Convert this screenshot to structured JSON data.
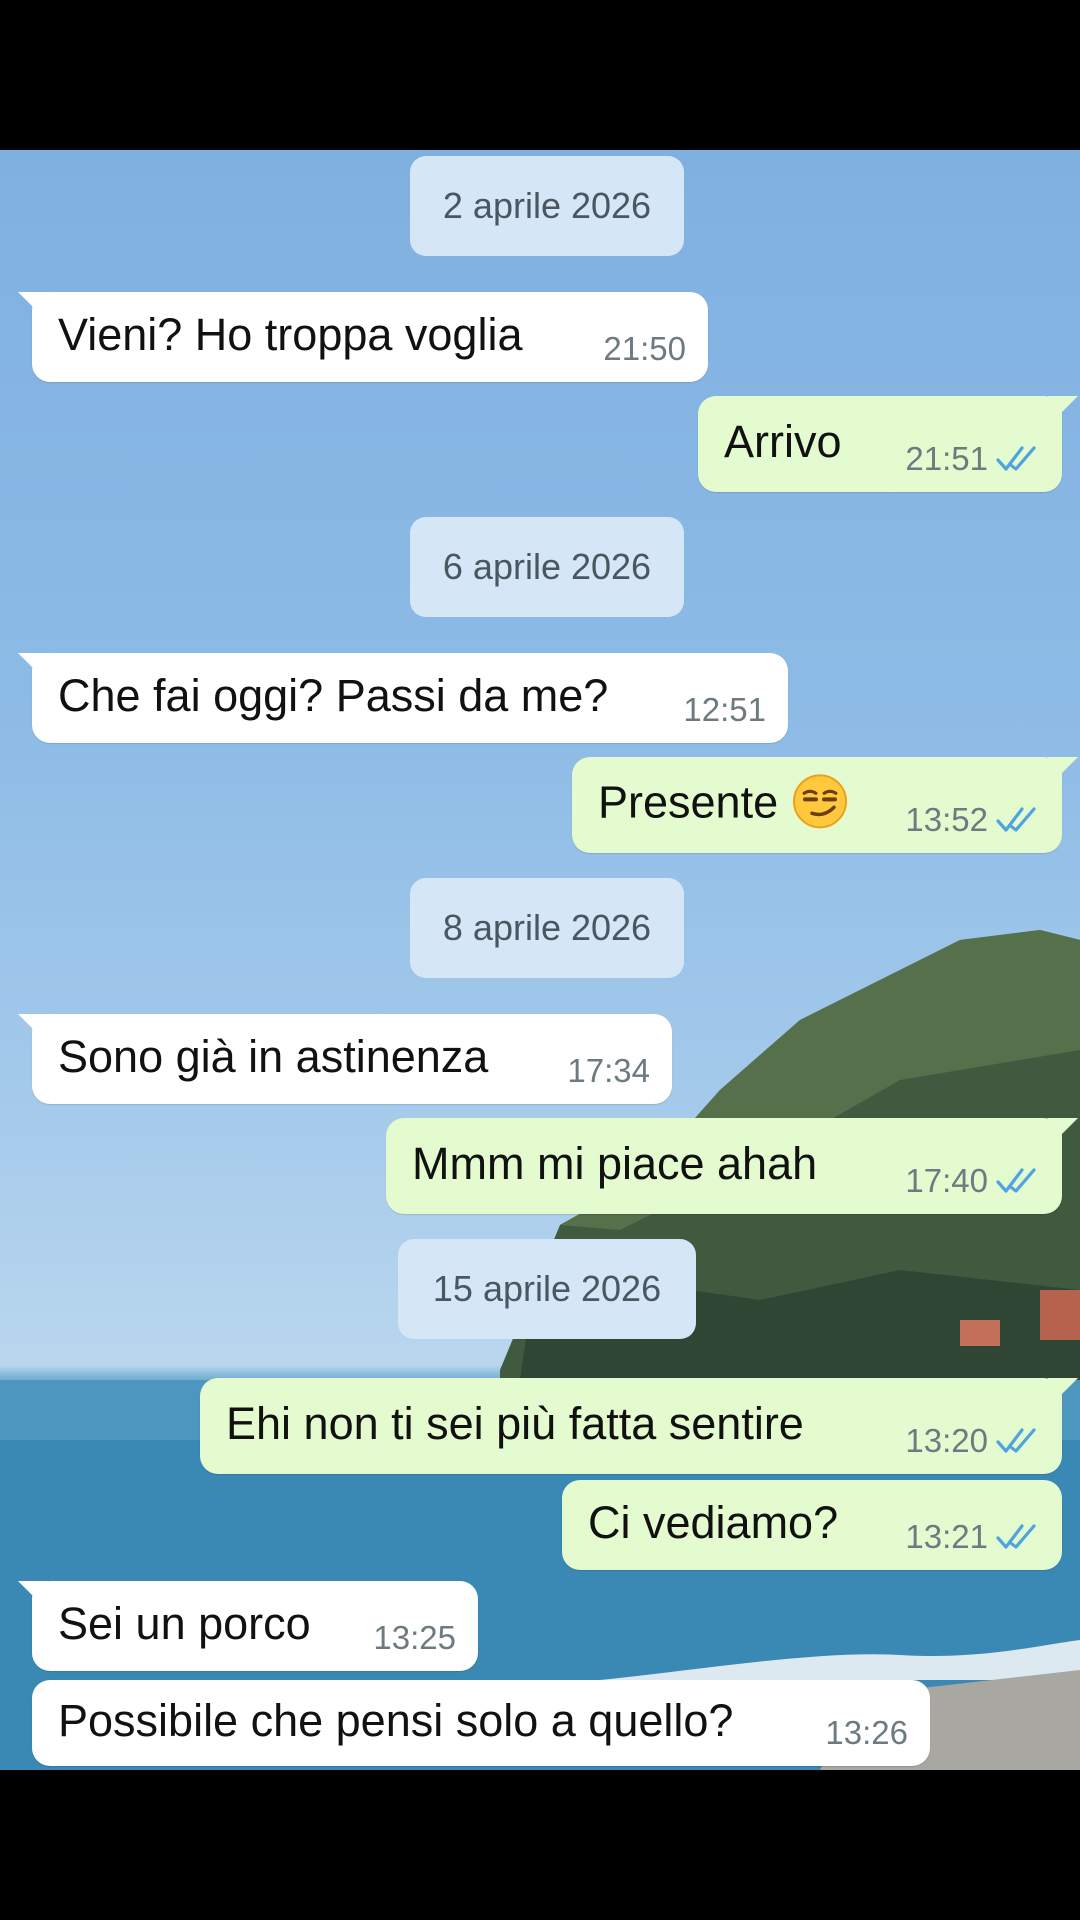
{
  "colors": {
    "incoming_bubble": "#ffffff",
    "outgoing_bubble": "#e3fbcf",
    "date_chip": "#d5e7f6",
    "read_ticks": "#4fa3e0"
  },
  "dates": [
    "2 aprile 2026",
    "6 aprile 2026",
    "8 aprile 2026",
    "15 aprile 2026"
  ],
  "messages": [
    {
      "dir": "in",
      "text": "Vieni? Ho troppa voglia",
      "time": "21:50"
    },
    {
      "dir": "out",
      "text": "Arrivo",
      "time": "21:51",
      "status": "read"
    },
    {
      "dir": "in",
      "text": "Che fai oggi? Passi da me?",
      "time": "12:51"
    },
    {
      "dir": "out",
      "text": "Presente",
      "emoji": "smirking-face",
      "time": "13:52",
      "status": "read"
    },
    {
      "dir": "in",
      "text": "Sono già in astinenza",
      "time": "17:34"
    },
    {
      "dir": "out",
      "text": "Mmm mi piace ahah",
      "time": "17:40",
      "status": "read"
    },
    {
      "dir": "out",
      "text": "Ehi non ti sei più fatta sentire",
      "time": "13:20",
      "status": "read"
    },
    {
      "dir": "out",
      "text": "Ci vediamo?",
      "time": "13:21",
      "status": "read"
    },
    {
      "dir": "in",
      "text": "Sei un porco",
      "time": "13:25"
    },
    {
      "dir": "in",
      "text": "Possibile che pensi solo a quello?",
      "time": "13:26"
    }
  ]
}
